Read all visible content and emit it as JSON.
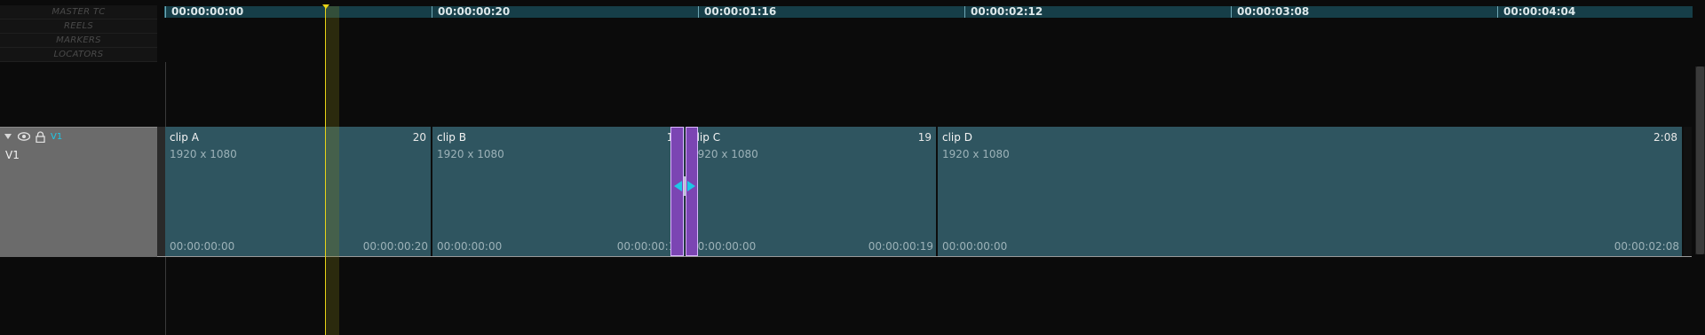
{
  "header_rows": [
    "MASTER TC",
    "REELS",
    "MARKERS",
    "LOCATORS"
  ],
  "ruler": {
    "ticks": [
      "00:00:00:00",
      "00:00:00:20",
      "00:00:01:16",
      "00:00:02:12",
      "00:00:03:08",
      "00:00:04:04"
    ]
  },
  "track": {
    "name": "V1",
    "header_label": "V1",
    "icons": [
      "expand-arrow-icon",
      "eye-icon",
      "lock-icon"
    ]
  },
  "clips": [
    {
      "name": "clip A",
      "duration": "20",
      "resolution": "1920 x 1080",
      "tc_in": "00:00:00:00",
      "tc_out": "00:00:00:20"
    },
    {
      "name": "clip B",
      "duration": "19",
      "resolution": "1920 x 1080",
      "tc_in": "00:00:00:00",
      "tc_out": "00:00:00:19"
    },
    {
      "name": "clip C",
      "duration": "19",
      "resolution": "1920 x 1080",
      "tc_in": "00:00:00:00",
      "tc_out": "00:00:00:19"
    },
    {
      "name": "clip D",
      "duration": "2:08",
      "resolution": "1920 x 1080",
      "tc_in": "00:00:00:00",
      "tc_out": "00:00:02:08"
    }
  ],
  "colors": {
    "clip": "#2f5560",
    "ruler": "#163e48",
    "playhead": "#e8d417",
    "selection": "#7b45b3",
    "trim_cursor": "#1ec8e6"
  }
}
